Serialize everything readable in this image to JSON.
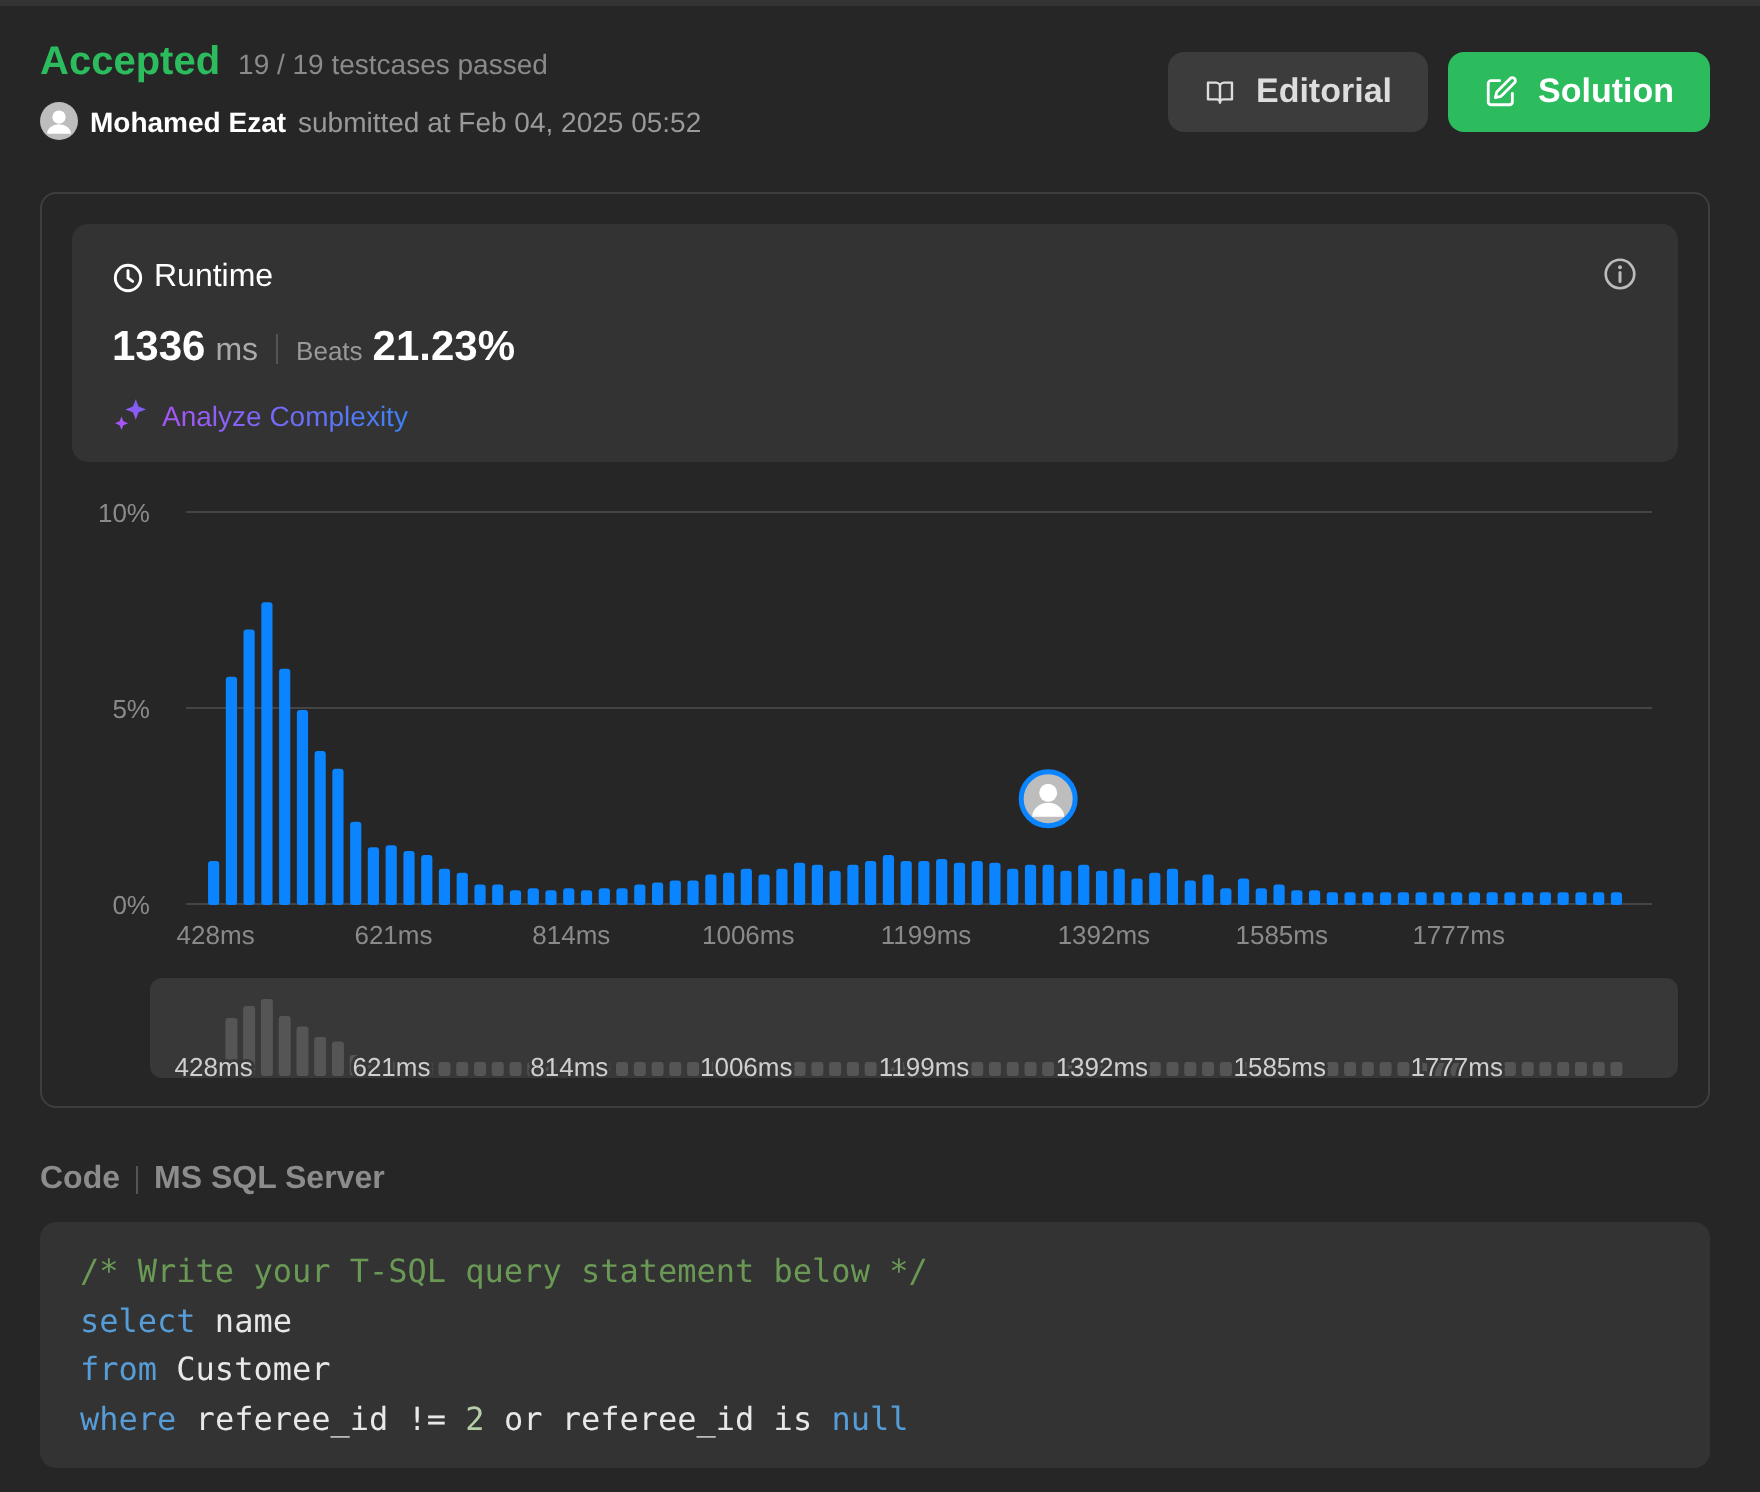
{
  "result": {
    "status": "Accepted",
    "testcases": "19 / 19 testcases passed",
    "user": "Mohamed Ezat",
    "submitted": "submitted at Feb 04, 2025 05:52"
  },
  "buttons": [
    {
      "label": "Editorial",
      "kind": "secondary"
    },
    {
      "label": "Solution",
      "kind": "primary"
    }
  ],
  "runtime": {
    "title": "Runtime",
    "value": "1336",
    "unit": "ms",
    "beats_label": "Beats",
    "beats": "21.23%",
    "analyze": "Analyze Complexity",
    "chart_data": {
      "type": "bar",
      "ylim": [
        0,
        10
      ],
      "yticks": [
        {
          "value": 0,
          "label": "0%"
        },
        {
          "value": 5,
          "label": "5%"
        },
        {
          "value": 10,
          "label": "10%"
        }
      ],
      "xticks": [
        {
          "value": 428,
          "label": "428ms"
        },
        {
          "value": 621,
          "label": "621ms"
        },
        {
          "value": 814,
          "label": "814ms"
        },
        {
          "value": 1006,
          "label": "1006ms"
        },
        {
          "value": 1199,
          "label": "1199ms"
        },
        {
          "value": 1392,
          "label": "1392ms"
        },
        {
          "value": 1585,
          "label": "1585ms"
        },
        {
          "value": 1777,
          "label": "1777ms"
        }
      ],
      "x": [
        428.0,
        447.3,
        466.5,
        485.8,
        505.1,
        524.4,
        543.6,
        562.9,
        582.2,
        601.4,
        620.7,
        640.0,
        659.3,
        678.5,
        697.8,
        717.1,
        736.3,
        755.6,
        774.9,
        794.1,
        813.4,
        832.7,
        852.0,
        871.2,
        890.5,
        909.8,
        929.0,
        948.3,
        967.6,
        986.9,
        1006.1,
        1025.4,
        1044.7,
        1063.9,
        1083.2,
        1102.5,
        1121.8,
        1141.0,
        1160.3,
        1179.6,
        1198.8,
        1218.1,
        1237.4,
        1256.7,
        1275.9,
        1295.2,
        1314.5,
        1333.7,
        1353.0,
        1372.3,
        1391.6,
        1410.8,
        1430.1,
        1449.4,
        1468.6,
        1487.9,
        1507.2,
        1526.5,
        1545.7,
        1565.0,
        1584.3,
        1603.5,
        1622.8,
        1642.1,
        1661.3,
        1680.6,
        1699.9,
        1719.2,
        1738.4,
        1757.7,
        1777.0,
        1796.3,
        1815.5,
        1834.8,
        1854.1,
        1873.3,
        1892.6,
        1911.9,
        1931.2,
        1950.4
      ],
      "series": [
        {
          "color": "#0a84ff",
          "values": [
            1.1,
            5.8,
            7.0,
            7.7,
            6.0,
            4.95,
            3.9,
            3.45,
            2.1,
            1.45,
            1.5,
            1.35,
            1.25,
            0.9,
            0.8,
            0.5,
            0.5,
            0.35,
            0.4,
            0.35,
            0.4,
            0.35,
            0.4,
            0.4,
            0.5,
            0.55,
            0.6,
            0.6,
            0.75,
            0.8,
            0.9,
            0.75,
            0.9,
            1.05,
            1.0,
            0.85,
            1.0,
            1.1,
            1.25,
            1.1,
            1.1,
            1.15,
            1.05,
            1.1,
            1.05,
            0.9,
            1.0,
            1.0,
            0.85,
            1.0,
            0.85,
            0.9,
            0.65,
            0.8,
            0.9,
            0.6,
            0.75,
            0.4,
            0.65,
            0.4,
            0.5,
            0.35,
            0.35,
            0.3,
            0.3,
            0.3,
            0.3,
            0.3,
            0.3,
            0.3,
            0.3,
            0.3,
            0.3,
            0.3,
            0.3,
            0.3,
            0.3,
            0.3,
            0.3,
            0.3
          ]
        }
      ],
      "xlim": [
        398,
        1989
      ]
    },
    "overview": {
      "labels": [
        "428ms",
        "621ms",
        "814ms",
        "1006ms",
        "1199ms",
        "1392ms",
        "1585ms",
        "1777ms"
      ]
    }
  },
  "code": {
    "label": "Code",
    "language": "MS SQL Server",
    "lines": [
      [
        {
          "text": "/* Write your T-SQL query statement below */",
          "kind": "comment"
        }
      ],
      [
        {
          "text": "select",
          "kind": "keyword"
        },
        {
          "text": " name",
          "kind": "plain"
        }
      ],
      [
        {
          "text": "from",
          "kind": "keyword"
        },
        {
          "text": " Customer",
          "kind": "plain"
        }
      ],
      [
        {
          "text": "where",
          "kind": "keyword"
        },
        {
          "text": " referee_id != ",
          "kind": "plain"
        },
        {
          "text": "2",
          "kind": "number"
        },
        {
          "text": " or referee_id is ",
          "kind": "plain"
        },
        {
          "text": "null",
          "kind": "keyword"
        }
      ]
    ]
  }
}
